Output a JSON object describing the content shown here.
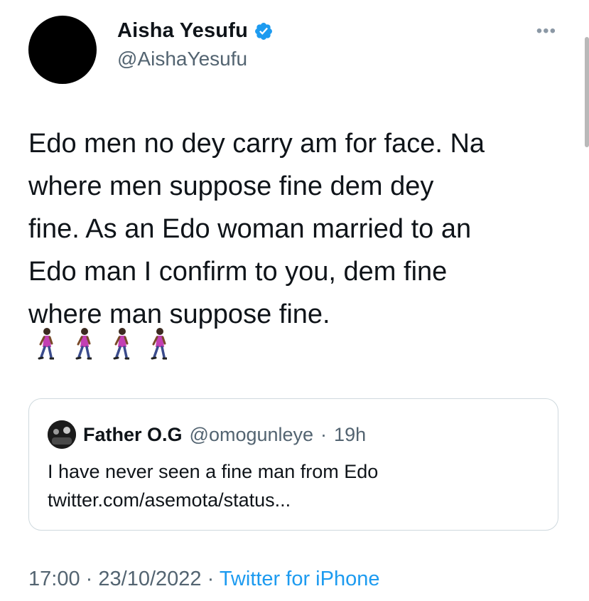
{
  "tweet": {
    "author": {
      "display_name": "Aisha Yesufu",
      "handle": "@AishaYesufu",
      "verified": true
    },
    "text_lines": [
      "Edo men no dey carry am for face. Na",
      "where men suppose fine dem dey",
      "fine. As an Edo woman married to an",
      "Edo man I confirm to you, dem fine",
      "where man suppose fine."
    ],
    "emoji_count": 4,
    "emoji_icon": "woman-walking-icon",
    "more_icon": "more-options-icon",
    "timestamp": "17:00",
    "separator": "·",
    "date": "23/10/2022",
    "source": "Twitter for iPhone"
  },
  "quote": {
    "display_name": "Father O.G",
    "handle": "@omogunleye",
    "separator": "·",
    "time": "19h",
    "text_lines": [
      "I have never seen a fine man from Edo",
      "twitter.com/asemota/status..."
    ]
  },
  "colors": {
    "text": "#0f1419",
    "secondary": "#536471",
    "link": "#1d9bf0",
    "verified": "#1d9bf0",
    "border": "#cfd9de"
  }
}
